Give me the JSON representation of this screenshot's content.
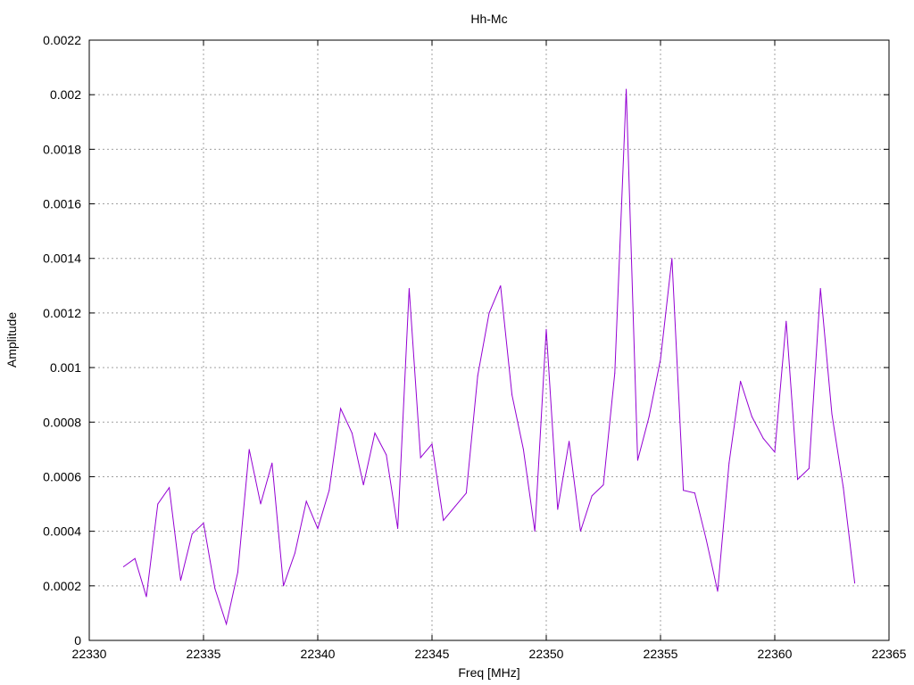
{
  "chart_data": {
    "type": "line",
    "title": "Hh-Mc",
    "xlabel": "Freq [MHz]",
    "ylabel": "Amplitude",
    "xlim": [
      22330,
      22365
    ],
    "ylim": [
      0,
      0.0022
    ],
    "grid": true,
    "x_ticks": [
      "22330",
      "22335",
      "22340",
      "22345",
      "22350",
      "22355",
      "22360",
      "22365"
    ],
    "y_ticks": [
      "0",
      "0.0002",
      "0.0004",
      "0.0006",
      "0.0008",
      "0.001",
      "0.0012",
      "0.0014",
      "0.0016",
      "0.0018",
      "0.002",
      "0.0022"
    ],
    "line_color": "#9400d3",
    "series": [
      {
        "x": [
          22331.5,
          22332.0,
          22332.5,
          22333.0,
          22333.5,
          22334.0,
          22334.5,
          22335.0,
          22335.5,
          22336.0,
          22336.5,
          22337.0,
          22337.5,
          22338.0,
          22338.5,
          22339.0,
          22339.5,
          22340.0,
          22340.5,
          22341.0,
          22341.5,
          22342.0,
          22342.5,
          22343.0,
          22343.5,
          22344.0,
          22344.5,
          22345.0,
          22345.5,
          22346.0,
          22346.5,
          22347.0,
          22347.5,
          22348.0,
          22348.5,
          22349.0,
          22349.5,
          22350.0,
          22350.5,
          22351.0,
          22351.5,
          22352.0,
          22352.5,
          22353.0,
          22353.5,
          22354.0,
          22354.5,
          22355.0,
          22355.5,
          22356.0,
          22356.5,
          22357.0,
          22357.5,
          22358.0,
          22358.5,
          22359.0,
          22359.5,
          22360.0,
          22360.5,
          22361.0,
          22361.5,
          22362.0,
          22362.5,
          22363.0,
          22363.5
        ],
        "values": [
          0.00027,
          0.0003,
          0.00016,
          0.0005,
          0.00056,
          0.00022,
          0.00039,
          0.00043,
          0.00019,
          6e-05,
          0.00025,
          0.0007,
          0.0005,
          0.00065,
          0.0002,
          0.00032,
          0.00051,
          0.00041,
          0.00055,
          0.00085,
          0.00076,
          0.00057,
          0.00076,
          0.00068,
          0.00041,
          0.00129,
          0.00067,
          0.00072,
          0.00044,
          0.00049,
          0.00054,
          0.00097,
          0.0012,
          0.0013,
          0.0009,
          0.0007,
          0.0004,
          0.00114,
          0.00048,
          0.00073,
          0.0004,
          0.00053,
          0.00057,
          0.00098,
          0.00202,
          0.00066,
          0.00082,
          0.00103,
          0.0014,
          0.00055,
          0.00054,
          0.00037,
          0.00018,
          0.00065,
          0.00095,
          0.00082,
          0.00074,
          0.00069,
          0.00117,
          0.00059,
          0.00063,
          0.00129,
          0.00083,
          0.00056,
          0.00021
        ]
      }
    ]
  }
}
